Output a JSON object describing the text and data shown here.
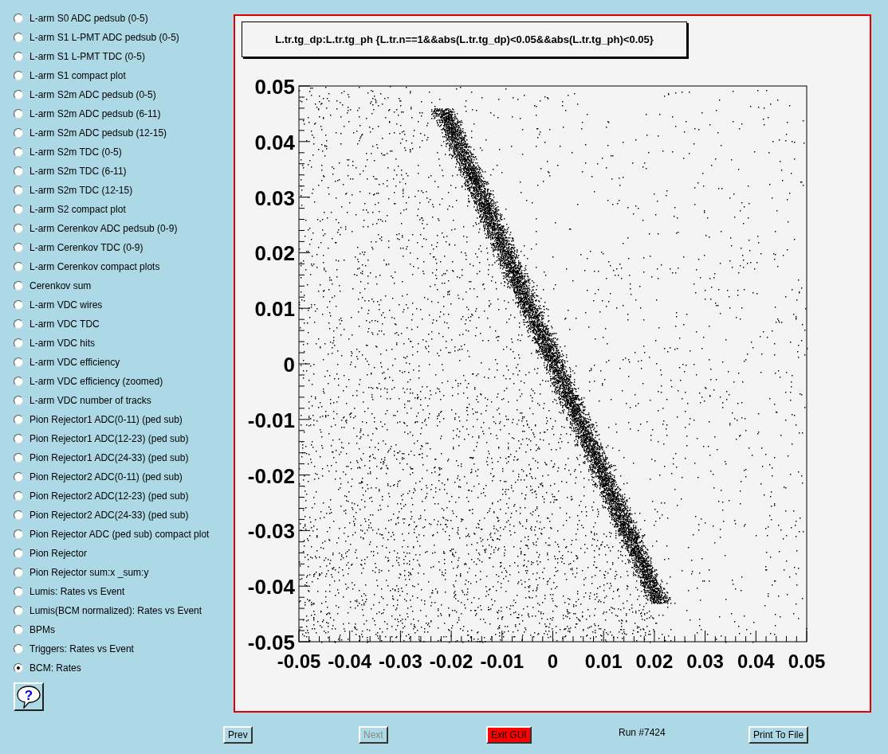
{
  "plot_list": [
    {
      "label": "L-arm S0 ADC pedsub (0-5)",
      "selected": false
    },
    {
      "label": "L-arm S1 L-PMT ADC pedsub (0-5)",
      "selected": false
    },
    {
      "label": "L-arm S1 L-PMT TDC (0-5)",
      "selected": false
    },
    {
      "label": "L-arm S1 compact plot",
      "selected": false
    },
    {
      "label": "L-arm S2m ADC pedsub (0-5)",
      "selected": false
    },
    {
      "label": "L-arm S2m ADC pedsub (6-11)",
      "selected": false
    },
    {
      "label": "L-arm S2m ADC pedsub (12-15)",
      "selected": false
    },
    {
      "label": "L-arm S2m TDC (0-5)",
      "selected": false
    },
    {
      "label": "L-arm S2m TDC (6-11)",
      "selected": false
    },
    {
      "label": "L-arm S2m TDC (12-15)",
      "selected": false
    },
    {
      "label": "L-arm S2 compact plot",
      "selected": false
    },
    {
      "label": "L-arm Cerenkov ADC pedsub (0-9)",
      "selected": false
    },
    {
      "label": "L-arm Cerenkov TDC (0-9)",
      "selected": false
    },
    {
      "label": "L-arm Cerenkov compact plots",
      "selected": false
    },
    {
      "label": "Cerenkov sum",
      "selected": false
    },
    {
      "label": "L-arm VDC wires",
      "selected": false
    },
    {
      "label": "L-arm VDC TDC",
      "selected": false
    },
    {
      "label": "L-arm VDC hits",
      "selected": false
    },
    {
      "label": "L-arm VDC efficiency",
      "selected": false
    },
    {
      "label": "L-arm VDC efficiency (zoomed)",
      "selected": false
    },
    {
      "label": "L-arm VDC number of tracks",
      "selected": false
    },
    {
      "label": "Pion Rejector1 ADC(0-11) (ped sub)",
      "selected": false
    },
    {
      "label": "Pion Rejector1 ADC(12-23) (ped sub)",
      "selected": false
    },
    {
      "label": "Pion Rejector1 ADC(24-33) (ped sub)",
      "selected": false
    },
    {
      "label": "Pion Rejector2 ADC(0-11) (ped sub)",
      "selected": false
    },
    {
      "label": "Pion Rejector2 ADC(12-23) (ped sub)",
      "selected": false
    },
    {
      "label": "Pion Rejector2 ADC(24-33) (ped sub)",
      "selected": false
    },
    {
      "label": "Pion Rejector ADC (ped sub) compact plot",
      "selected": false
    },
    {
      "label": "Pion Rejector",
      "selected": false
    },
    {
      "label": "Pion Rejector sum:x _sum:y",
      "selected": false
    },
    {
      "label": "Lumis: Rates vs Event",
      "selected": false
    },
    {
      "label": "Lumis(BCM normalized): Rates vs Event",
      "selected": false
    },
    {
      "label": "BPMs",
      "selected": false
    },
    {
      "label": "Triggers: Rates vs Event",
      "selected": false
    },
    {
      "label": "BCM: Rates",
      "selected": true
    }
  ],
  "help_button": {
    "label": "?"
  },
  "plot": {
    "title": "L.tr.tg_dp:L.tr.tg_ph {L.tr.n==1&&abs(L.tr.tg_dp)<0.05&&abs(L.tr.tg_ph)<0.05}",
    "y_tick_labels": [
      "0.05",
      "0.04",
      "0.03",
      "0.02",
      "0.01",
      "0",
      "-0.01",
      "-0.02",
      "-0.03",
      "-0.04",
      "-0.05"
    ],
    "x_tick_labels": [
      "-0.05",
      "-0.04",
      "-0.03",
      "-0.02",
      "-0.01",
      "0",
      "0.01",
      "0.02",
      "0.03",
      "0.04",
      "0.05"
    ]
  },
  "footer": [
    {
      "kind": "button",
      "label": "Prev",
      "disabled": false
    },
    {
      "kind": "button",
      "label": "Next",
      "disabled": true
    },
    {
      "kind": "danger_button",
      "label": "Exit GUI",
      "disabled": false
    },
    {
      "kind": "label",
      "label": "Run #7424"
    },
    {
      "kind": "button",
      "label": "Print To File",
      "disabled": false
    }
  ]
}
